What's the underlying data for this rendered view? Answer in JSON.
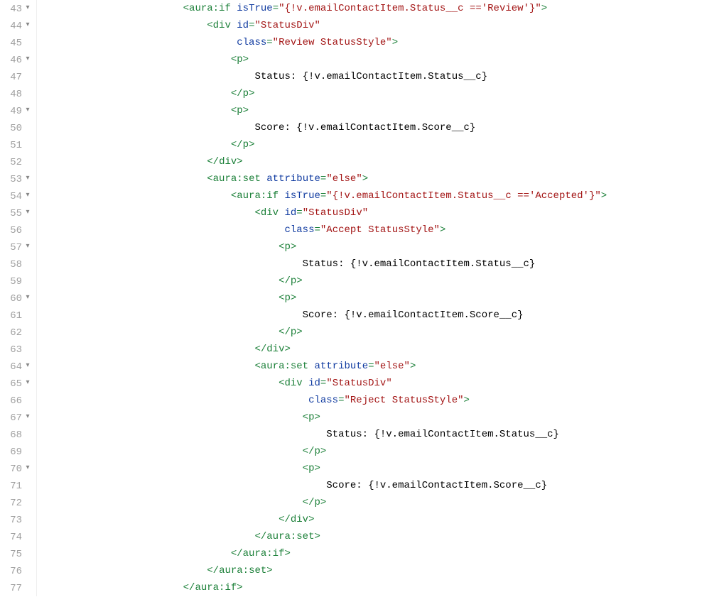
{
  "lines": [
    {
      "num": 43,
      "fold": true,
      "tokens": [
        [
          "txt",
          "                        "
        ],
        [
          "punct",
          "<"
        ],
        [
          "tag",
          "aura:if"
        ],
        [
          "txt",
          " "
        ],
        [
          "attr",
          "isTrue"
        ],
        [
          "punct",
          "="
        ],
        [
          "str",
          "\"{!v.emailContactItem.Status__c =='Review'}\""
        ],
        [
          "punct",
          ">"
        ]
      ]
    },
    {
      "num": 44,
      "fold": true,
      "tokens": [
        [
          "txt",
          "                            "
        ],
        [
          "punct",
          "<"
        ],
        [
          "tag",
          "div"
        ],
        [
          "txt",
          " "
        ],
        [
          "attr",
          "id"
        ],
        [
          "punct",
          "="
        ],
        [
          "str",
          "\"StatusDiv\""
        ]
      ]
    },
    {
      "num": 45,
      "fold": false,
      "tokens": [
        [
          "txt",
          "                                 "
        ],
        [
          "attr",
          "class"
        ],
        [
          "punct",
          "="
        ],
        [
          "str",
          "\"Review StatusStyle\""
        ],
        [
          "punct",
          ">"
        ]
      ]
    },
    {
      "num": 46,
      "fold": true,
      "tokens": [
        [
          "txt",
          "                                "
        ],
        [
          "punct",
          "<"
        ],
        [
          "tag",
          "p"
        ],
        [
          "punct",
          ">"
        ]
      ]
    },
    {
      "num": 47,
      "fold": false,
      "tokens": [
        [
          "txt",
          "                                    Status: {!v.emailContactItem.Status__c}"
        ]
      ]
    },
    {
      "num": 48,
      "fold": false,
      "tokens": [
        [
          "txt",
          "                                "
        ],
        [
          "punct",
          "</"
        ],
        [
          "tag",
          "p"
        ],
        [
          "punct",
          ">"
        ]
      ]
    },
    {
      "num": 49,
      "fold": true,
      "tokens": [
        [
          "txt",
          "                                "
        ],
        [
          "punct",
          "<"
        ],
        [
          "tag",
          "p"
        ],
        [
          "punct",
          ">"
        ]
      ]
    },
    {
      "num": 50,
      "fold": false,
      "tokens": [
        [
          "txt",
          "                                    Score: {!v.emailContactItem.Score__c}"
        ]
      ]
    },
    {
      "num": 51,
      "fold": false,
      "tokens": [
        [
          "txt",
          "                                "
        ],
        [
          "punct",
          "</"
        ],
        [
          "tag",
          "p"
        ],
        [
          "punct",
          ">"
        ]
      ]
    },
    {
      "num": 52,
      "fold": false,
      "tokens": [
        [
          "txt",
          "                            "
        ],
        [
          "punct",
          "</"
        ],
        [
          "tag",
          "div"
        ],
        [
          "punct",
          ">"
        ]
      ]
    },
    {
      "num": 53,
      "fold": true,
      "tokens": [
        [
          "txt",
          "                            "
        ],
        [
          "punct",
          "<"
        ],
        [
          "tag",
          "aura:set"
        ],
        [
          "txt",
          " "
        ],
        [
          "attr",
          "attribute"
        ],
        [
          "punct",
          "="
        ],
        [
          "str",
          "\"else\""
        ],
        [
          "punct",
          ">"
        ]
      ]
    },
    {
      "num": 54,
      "fold": true,
      "tokens": [
        [
          "txt",
          "                                "
        ],
        [
          "punct",
          "<"
        ],
        [
          "tag",
          "aura:if"
        ],
        [
          "txt",
          " "
        ],
        [
          "attr",
          "isTrue"
        ],
        [
          "punct",
          "="
        ],
        [
          "str",
          "\"{!v.emailContactItem.Status__c =='Accepted'}\""
        ],
        [
          "punct",
          ">"
        ]
      ]
    },
    {
      "num": 55,
      "fold": true,
      "tokens": [
        [
          "txt",
          "                                    "
        ],
        [
          "punct",
          "<"
        ],
        [
          "tag",
          "div"
        ],
        [
          "txt",
          " "
        ],
        [
          "attr",
          "id"
        ],
        [
          "punct",
          "="
        ],
        [
          "str",
          "\"StatusDiv\""
        ]
      ]
    },
    {
      "num": 56,
      "fold": false,
      "tokens": [
        [
          "txt",
          "                                         "
        ],
        [
          "attr",
          "class"
        ],
        [
          "punct",
          "="
        ],
        [
          "str",
          "\"Accept StatusStyle\""
        ],
        [
          "punct",
          ">"
        ]
      ]
    },
    {
      "num": 57,
      "fold": true,
      "tokens": [
        [
          "txt",
          "                                        "
        ],
        [
          "punct",
          "<"
        ],
        [
          "tag",
          "p"
        ],
        [
          "punct",
          ">"
        ]
      ]
    },
    {
      "num": 58,
      "fold": false,
      "tokens": [
        [
          "txt",
          "                                            Status: {!v.emailContactItem.Status__c}"
        ]
      ]
    },
    {
      "num": 59,
      "fold": false,
      "tokens": [
        [
          "txt",
          "                                        "
        ],
        [
          "punct",
          "</"
        ],
        [
          "tag",
          "p"
        ],
        [
          "punct",
          ">"
        ]
      ]
    },
    {
      "num": 60,
      "fold": true,
      "tokens": [
        [
          "txt",
          "                                        "
        ],
        [
          "punct",
          "<"
        ],
        [
          "tag",
          "p"
        ],
        [
          "punct",
          ">"
        ]
      ]
    },
    {
      "num": 61,
      "fold": false,
      "tokens": [
        [
          "txt",
          "                                            Score: {!v.emailContactItem.Score__c}"
        ]
      ]
    },
    {
      "num": 62,
      "fold": false,
      "tokens": [
        [
          "txt",
          "                                        "
        ],
        [
          "punct",
          "</"
        ],
        [
          "tag",
          "p"
        ],
        [
          "punct",
          ">"
        ]
      ]
    },
    {
      "num": 63,
      "fold": false,
      "tokens": [
        [
          "txt",
          "                                    "
        ],
        [
          "punct",
          "</"
        ],
        [
          "tag",
          "div"
        ],
        [
          "punct",
          ">"
        ]
      ]
    },
    {
      "num": 64,
      "fold": true,
      "tokens": [
        [
          "txt",
          "                                    "
        ],
        [
          "punct",
          "<"
        ],
        [
          "tag",
          "aura:set"
        ],
        [
          "txt",
          " "
        ],
        [
          "attr",
          "attribute"
        ],
        [
          "punct",
          "="
        ],
        [
          "str",
          "\"else\""
        ],
        [
          "punct",
          ">"
        ]
      ]
    },
    {
      "num": 65,
      "fold": true,
      "tokens": [
        [
          "txt",
          "                                        "
        ],
        [
          "punct",
          "<"
        ],
        [
          "tag",
          "div"
        ],
        [
          "txt",
          " "
        ],
        [
          "attr",
          "id"
        ],
        [
          "punct",
          "="
        ],
        [
          "str",
          "\"StatusDiv\""
        ]
      ]
    },
    {
      "num": 66,
      "fold": false,
      "tokens": [
        [
          "txt",
          "                                             "
        ],
        [
          "attr",
          "class"
        ],
        [
          "punct",
          "="
        ],
        [
          "str",
          "\"Reject StatusStyle\""
        ],
        [
          "punct",
          ">"
        ]
      ]
    },
    {
      "num": 67,
      "fold": true,
      "tokens": [
        [
          "txt",
          "                                            "
        ],
        [
          "punct",
          "<"
        ],
        [
          "tag",
          "p"
        ],
        [
          "punct",
          ">"
        ]
      ]
    },
    {
      "num": 68,
      "fold": false,
      "tokens": [
        [
          "txt",
          "                                                Status: {!v.emailContactItem.Status__c}"
        ]
      ]
    },
    {
      "num": 69,
      "fold": false,
      "tokens": [
        [
          "txt",
          "                                            "
        ],
        [
          "punct",
          "</"
        ],
        [
          "tag",
          "p"
        ],
        [
          "punct",
          ">"
        ]
      ]
    },
    {
      "num": 70,
      "fold": true,
      "tokens": [
        [
          "txt",
          "                                            "
        ],
        [
          "punct",
          "<"
        ],
        [
          "tag",
          "p"
        ],
        [
          "punct",
          ">"
        ]
      ]
    },
    {
      "num": 71,
      "fold": false,
      "tokens": [
        [
          "txt",
          "                                                Score: {!v.emailContactItem.Score__c}"
        ]
      ]
    },
    {
      "num": 72,
      "fold": false,
      "tokens": [
        [
          "txt",
          "                                            "
        ],
        [
          "punct",
          "</"
        ],
        [
          "tag",
          "p"
        ],
        [
          "punct",
          ">"
        ]
      ]
    },
    {
      "num": 73,
      "fold": false,
      "tokens": [
        [
          "txt",
          "                                        "
        ],
        [
          "punct",
          "</"
        ],
        [
          "tag",
          "div"
        ],
        [
          "punct",
          ">"
        ]
      ]
    },
    {
      "num": 74,
      "fold": false,
      "tokens": [
        [
          "txt",
          "                                    "
        ],
        [
          "punct",
          "</"
        ],
        [
          "tag",
          "aura:set"
        ],
        [
          "punct",
          ">"
        ]
      ]
    },
    {
      "num": 75,
      "fold": false,
      "tokens": [
        [
          "txt",
          "                                "
        ],
        [
          "punct",
          "</"
        ],
        [
          "tag",
          "aura:if"
        ],
        [
          "punct",
          ">"
        ]
      ]
    },
    {
      "num": 76,
      "fold": false,
      "tokens": [
        [
          "txt",
          "                            "
        ],
        [
          "punct",
          "</"
        ],
        [
          "tag",
          "aura:set"
        ],
        [
          "punct",
          ">"
        ]
      ]
    },
    {
      "num": 77,
      "fold": false,
      "tokens": [
        [
          "txt",
          "                        "
        ],
        [
          "punct",
          "</"
        ],
        [
          "tag",
          "aura:if"
        ],
        [
          "punct",
          ">"
        ]
      ]
    }
  ],
  "fold_glyph": "▾"
}
